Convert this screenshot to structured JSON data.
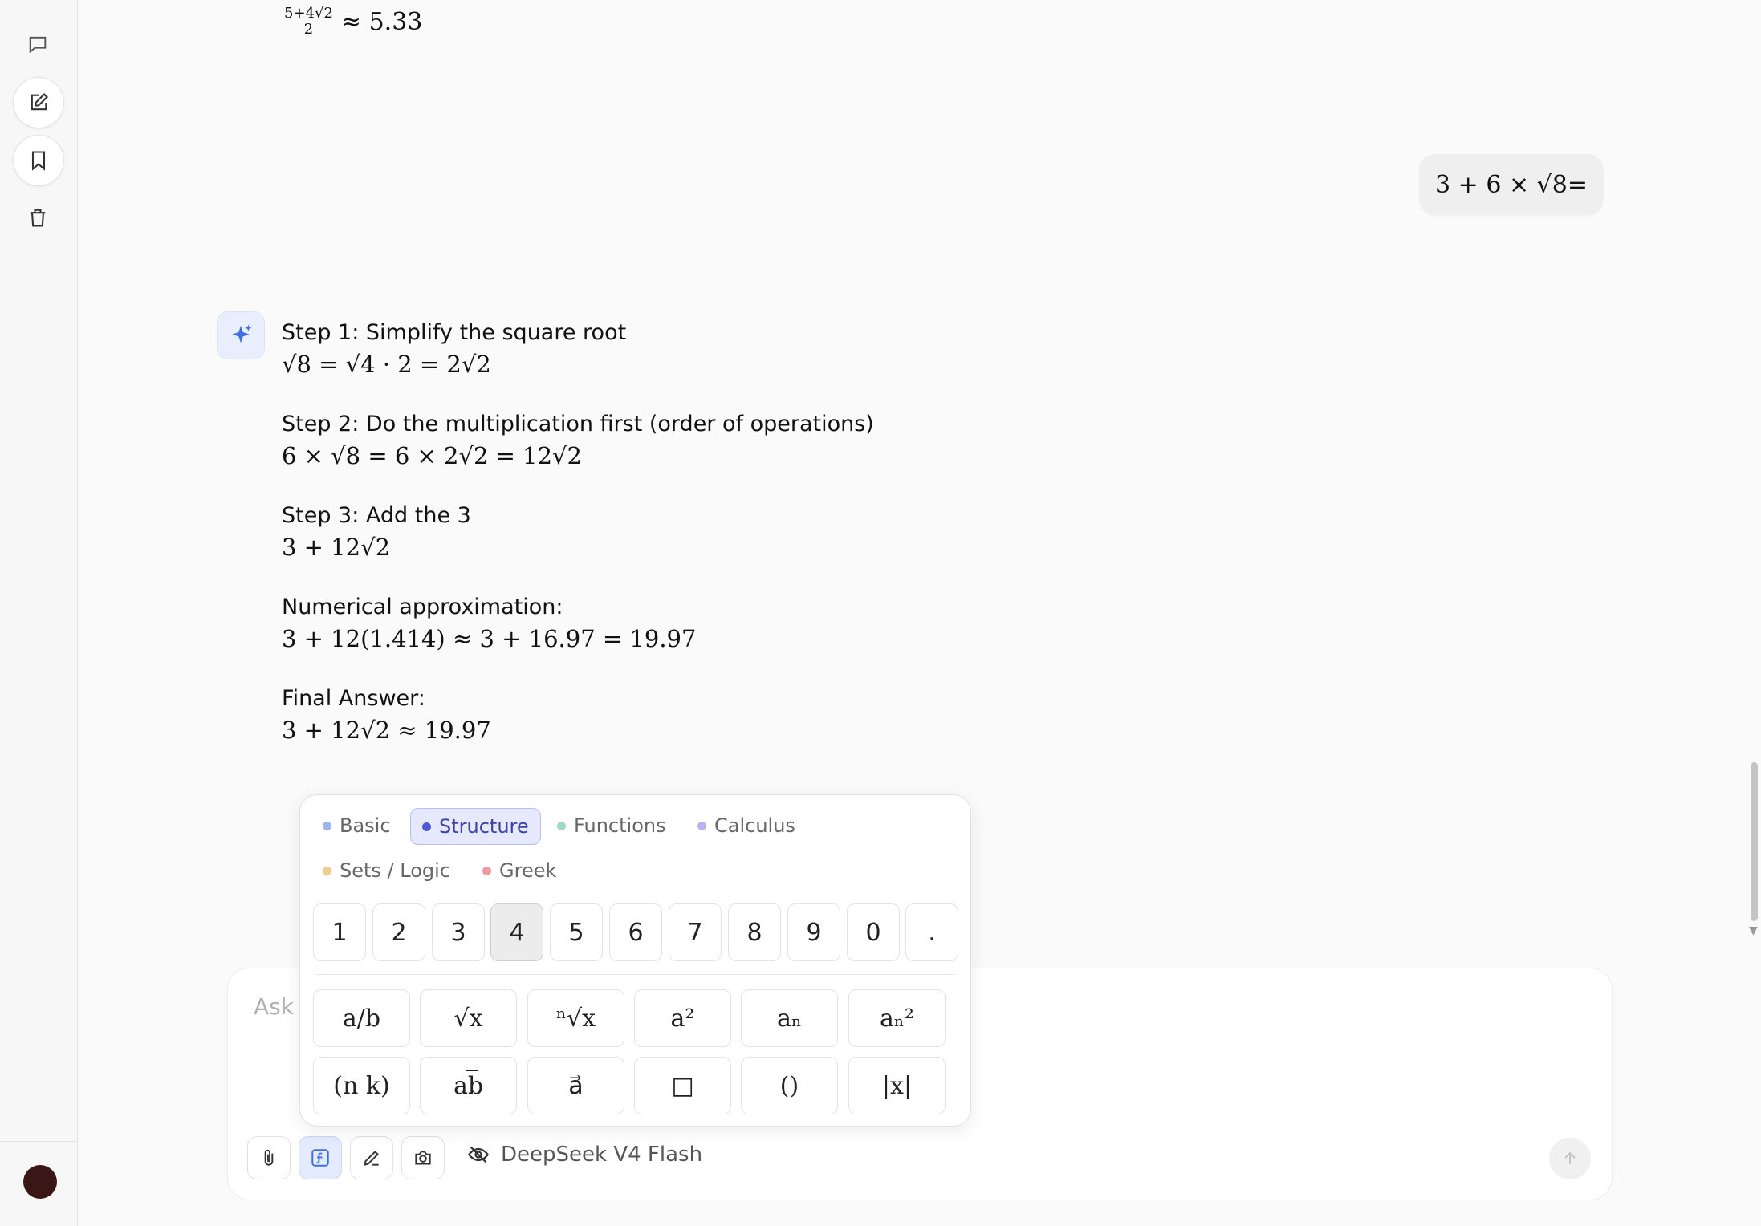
{
  "conversation": {
    "prev_result": {
      "frac_num": "5+4√2",
      "frac_den": "2",
      "rest": "≈ 5.33"
    },
    "user_message": "3 + 6 × √8=",
    "answer": {
      "step1_title": "Step 1: Simplify the square root",
      "step1_math": "√8 = √4 · 2 = 2√2",
      "step2_title": "Step 2: Do the multiplication first (order of operations)",
      "step2_math": "6 × √8 = 6 × 2√2 = 12√2",
      "step3_title": "Step 3: Add the 3",
      "step3_math": "3 + 12√2",
      "approx_title": "Numerical approximation:",
      "approx_math": "3 + 12(1.414) ≈ 3 + 16.97 = 19.97",
      "final_title": "Final Answer:",
      "final_math": "3 + 12√2 ≈ 19.97"
    }
  },
  "keyboard": {
    "tabs": [
      {
        "label": "Basic",
        "color": "#9db3f5"
      },
      {
        "label": "Structure",
        "color": "#4f59d6",
        "selected": true
      },
      {
        "label": "Functions",
        "color": "#9fd9c3"
      },
      {
        "label": "Calculus",
        "color": "#b8b2f0"
      },
      {
        "label": "Sets / Logic",
        "color": "#f2cc8a"
      },
      {
        "label": "Greek",
        "color": "#ef9aa5"
      }
    ],
    "digits": [
      "1",
      "2",
      "3",
      "4",
      "5",
      "6",
      "7",
      "8",
      "9",
      "0",
      "."
    ],
    "pressed_digit": "4",
    "symbols_row1": [
      "a/b",
      "√x",
      "ⁿ√x",
      "a²",
      "aₙ",
      "aₙ²"
    ],
    "symbols_row2": [
      "(n k)",
      "ab̅",
      "a⃗",
      "□",
      "()",
      "|x|"
    ]
  },
  "composer": {
    "placeholder": "Ask",
    "model_name": "DeepSeek V4 Flash",
    "tools": [
      "paperclip-icon",
      "formula-icon",
      "pen-icon",
      "camera-icon"
    ]
  },
  "sidebar": {
    "items": [
      "chat-icon",
      "new-chat-icon",
      "bookmark-icon",
      "trash-icon"
    ]
  },
  "colors": {
    "accent": "#4f59d6",
    "ai_badge": "#e8eefc",
    "avatar": "#3b1616"
  }
}
